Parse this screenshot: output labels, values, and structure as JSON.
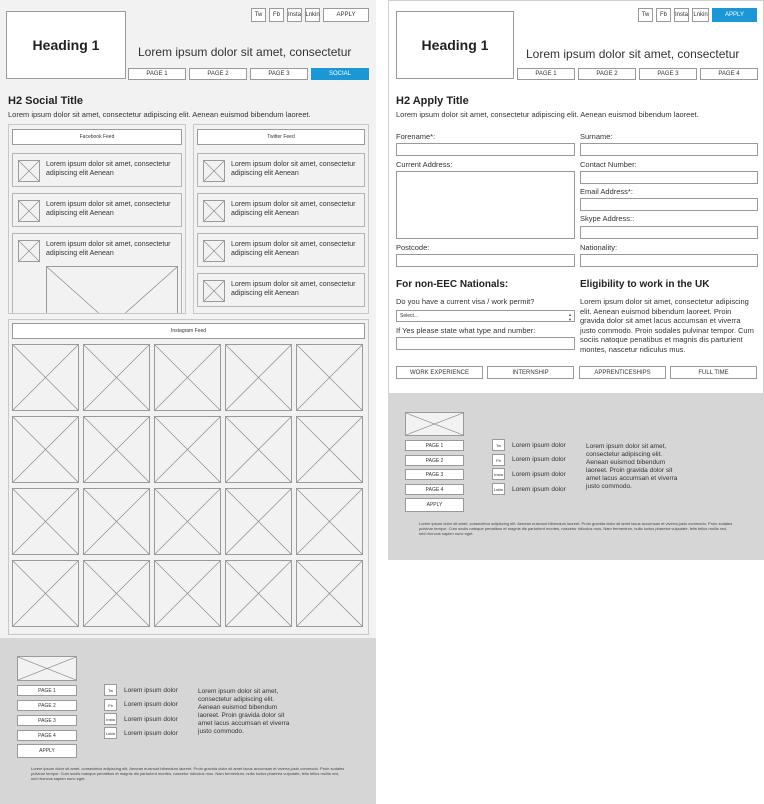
{
  "left": {
    "header": {
      "heading1": "Heading 1",
      "tagline": "Lorem ipsum dolor sit amet, consectetur",
      "social_buttons": [
        "Tw",
        "Fb",
        "Insta",
        "Lnkin"
      ],
      "apply_label": "APPLY",
      "nav": [
        "PAGE 1",
        "PAGE 2",
        "PAGE 3",
        "SOCIAL"
      ],
      "active_nav": "SOCIAL"
    },
    "section": {
      "title": "H2 Social Title",
      "lede": "Lorem ipsum dolor sit amet, consectetur adipiscing elit. Aenean euismod bibendum laoreet."
    },
    "facebook": {
      "label": "Facebook Feed",
      "items": [
        "Lorem ipsum dolor sit amet, consectetur adipiscing elit Aenean",
        "Lorem ipsum dolor sit amet, consectetur adipiscing elit Aenean",
        "Lorem ipsum dolor sit amet, consectetur adipiscing elit Aenean"
      ]
    },
    "twitter": {
      "label": "Twitter Feed",
      "items": [
        "Lorem ipsum dolor sit amet, consectetur adipiscing elit Aenean",
        "Lorem ipsum dolor sit amet, consectetur adipiscing elit Aenean",
        "Lorem ipsum dolor sit amet, consectetur adipiscing elit Aenean",
        "Lorem ipsum dolor sit amet, consectetur adipiscing elit Aenean"
      ]
    },
    "instagram": {
      "label": "Instagram Feed"
    },
    "footer": {
      "nav": [
        "PAGE 1",
        "PAGE 2",
        "PAGE 3",
        "PAGE 4",
        "APPLY"
      ],
      "social": [
        {
          "icon": "Tw",
          "text": "Lorem ipsum dolor"
        },
        {
          "icon": "Fb",
          "text": "Lorem ipsum dolor"
        },
        {
          "icon": "Insta",
          "text": "Lorem ipsum dolor"
        },
        {
          "icon": "Lnkin",
          "text": "Lorem ipsum dolor"
        }
      ],
      "about": "Lorem ipsum dolor sit amet, consectetur adipiscing elit. Aenean euismod bibendum laoreet. Proin gravida dolor sit amet lacus accumsan et viverra justo commodo.",
      "smallprint": "Lorem ipsum dolor sit amet, consectetur adipiscing elit. Aenean euismod bibendum laoreet. Proin gravida dolor sit amet lacus accumsan et viverra justo commodo. Proin sodales pulvinar tempor. Cum sociis natoque penatibus et magnis dis parturient montes, nascetur ridiculus mus. Nam fermentum, nulla luctus pharetra vulputate, felis tellus mollis orci, sed rhoncus sapien nunc eget."
    }
  },
  "right": {
    "header": {
      "heading1": "Heading 1",
      "tagline": "Lorem ipsum dolor sit amet, consectetur",
      "social_buttons": [
        "Tw",
        "Fb",
        "Insta",
        "Lnkin"
      ],
      "apply_label": "APPLY",
      "nav": [
        "PAGE 1",
        "PAGE 2",
        "PAGE 3",
        "PAGE 4"
      ],
      "active_nav": "APPLY"
    },
    "section": {
      "title": "H2 Apply Title",
      "lede": "Lorem ipsum dolor sit amet, consectetur adipiscing elit. Aenean euismod bibendum laoreet."
    },
    "form": {
      "forename": "Forename*:",
      "surname": "Surname:",
      "address": "Current Address:",
      "contact": "Contact Number:",
      "email": "Email Address*:",
      "skype": "Skype Address::",
      "postcode": "Postcode:",
      "nationality": "Nationality:"
    },
    "non_eec": {
      "title": "For non-EEC Nationals:",
      "visa_question": "Do you have a current visa / work permit?",
      "select_value": "Select...",
      "type_question": "If Yes please state what type and number:"
    },
    "eligibility": {
      "title": "Eligibility to work in the UK",
      "text": "Lorem ipsum dolor sit amet, consectetur adipiscing elit. Aenean euismod bibendum laoreet. Proin gravida dolor sit amet lacus accumsan et viverra justo commodo. Proin sodales pulvinar tempor. Cum sociis natoque penatibus et magnis dis parturient montes, nascetur ridiculus mus."
    },
    "tabs": [
      "WORK EXPERIENCE",
      "INTERNSHIP",
      "APPRENTICESHIPS",
      "FULL TIME"
    ],
    "footer": {
      "nav": [
        "PAGE 1",
        "PAGE 2",
        "PAGE 3",
        "PAGE 4",
        "APPLY"
      ],
      "social": [
        {
          "icon": "Tw",
          "text": "Lorem ipsum dolor"
        },
        {
          "icon": "Fb",
          "text": "Lorem ipsum dolor"
        },
        {
          "icon": "Insta",
          "text": "Lorem ipsum dolor"
        },
        {
          "icon": "Lnkin",
          "text": "Lorem ipsum dolor"
        }
      ],
      "about": "Lorem ipsum dolor sit amet, consectetur adipiscing elit. Aenean euismod bibendum laoreet. Proin gravida dolor sit amet lacus accumsan et viverra justo commodo.",
      "smallprint": "Lorem ipsum dolor sit amet, consectetur adipiscing elit. Aenean euismod bibendum laoreet. Proin gravida dolor sit amet lacus accumsan et viverra justo commodo. Proin sodales pulvinar tempor. Cum sociis natoque penatibus et magnis dis parturient montes, nascetur ridiculus mus. Nam fermentum, nulla luctus pharetra vulputate, felis tellus mollis orci, sed rhoncus sapien nunc eget."
    }
  }
}
